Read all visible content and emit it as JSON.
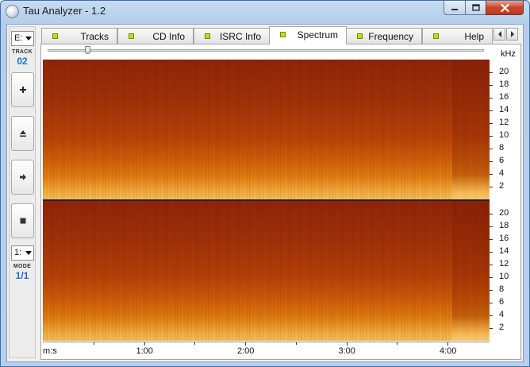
{
  "window": {
    "title": "Tau Analyzer - 1.2"
  },
  "left_toolbar": {
    "drive_value": "E:",
    "track_label": "TRACK",
    "track_value": "02",
    "buttons": [
      {
        "name": "add-button",
        "icon": "plus-icon"
      },
      {
        "name": "eject-button",
        "icon": "eject-icon"
      },
      {
        "name": "play-button",
        "icon": "arrow-right-icon"
      },
      {
        "name": "stop-button",
        "icon": "stop-icon"
      }
    ],
    "mode_select_value": "1:",
    "mode_label": "MODE",
    "mode_value": "1/1"
  },
  "tabs": [
    {
      "label": "Tracks",
      "active": false
    },
    {
      "label": "CD Info",
      "active": false
    },
    {
      "label": "ISRC Info",
      "active": false
    },
    {
      "label": "Spectrum",
      "active": true
    },
    {
      "label": "Frequency",
      "active": false
    },
    {
      "label": "Help",
      "active": false
    }
  ],
  "spectrum": {
    "unit": "kHz",
    "y_labels": [
      "20",
      "18",
      "16",
      "14",
      "12",
      "10",
      "8",
      "6",
      "4",
      "2"
    ],
    "x_labels": [
      "m:s",
      "1:00",
      "2:00",
      "3:00",
      "4:00"
    ],
    "channels": 2,
    "zoom_slider": 0.09
  },
  "colors": {
    "spectrogram_low": "#f6c15d",
    "spectrogram_high": "#8f2509",
    "tab_led": "#b8e600"
  }
}
